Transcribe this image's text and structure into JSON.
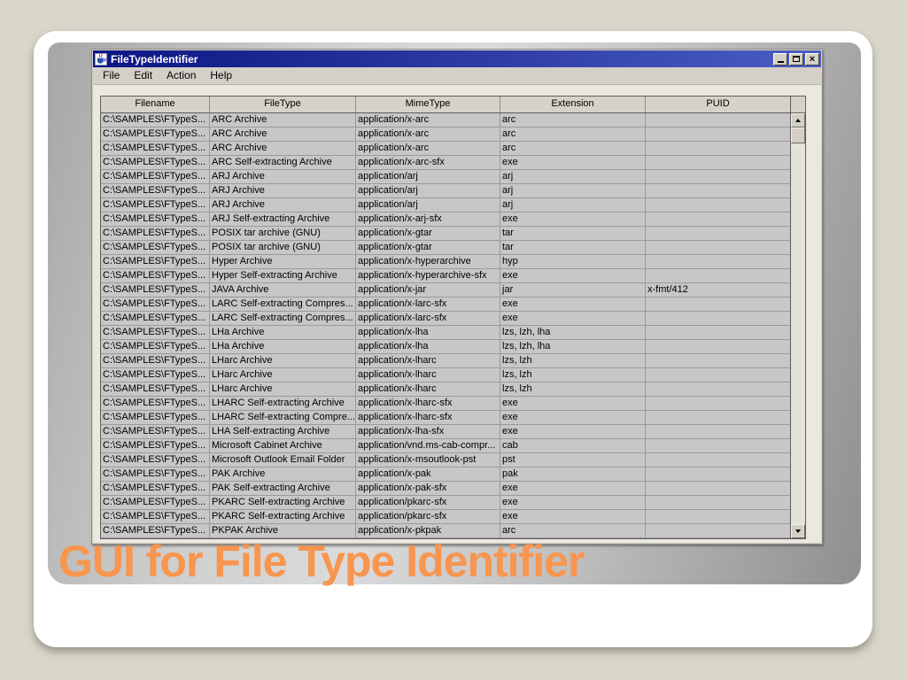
{
  "slide": {
    "title": "GUI for File Type Identifier",
    "accent_color": "#f8954f"
  },
  "window": {
    "title": "FileTypeIdentifier",
    "icon": "java-coffee-cup-icon",
    "controls": {
      "minimize": "minimize",
      "maximize": "maximize",
      "close": "×"
    },
    "menu": [
      "File",
      "Edit",
      "Action",
      "Help"
    ],
    "table": {
      "columns": [
        "Filename",
        "FileType",
        "MimeType",
        "Extension",
        "PUID"
      ],
      "rows": [
        [
          "C:\\SAMPLES\\FTypeS...",
          "ARC Archive",
          "application/x-arc",
          "arc",
          ""
        ],
        [
          "C:\\SAMPLES\\FTypeS...",
          "ARC Archive",
          "application/x-arc",
          "arc",
          ""
        ],
        [
          "C:\\SAMPLES\\FTypeS...",
          "ARC Archive",
          "application/x-arc",
          "arc",
          ""
        ],
        [
          "C:\\SAMPLES\\FTypeS...",
          "ARC Self-extracting Archive",
          "application/x-arc-sfx",
          "exe",
          ""
        ],
        [
          "C:\\SAMPLES\\FTypeS...",
          "ARJ Archive",
          "application/arj",
          "arj",
          ""
        ],
        [
          "C:\\SAMPLES\\FTypeS...",
          "ARJ Archive",
          "application/arj",
          "arj",
          ""
        ],
        [
          "C:\\SAMPLES\\FTypeS...",
          "ARJ Archive",
          "application/arj",
          "arj",
          ""
        ],
        [
          "C:\\SAMPLES\\FTypeS...",
          "ARJ Self-extracting Archive",
          "application/x-arj-sfx",
          "exe",
          ""
        ],
        [
          "C:\\SAMPLES\\FTypeS...",
          "POSIX tar archive (GNU)",
          "application/x-gtar",
          "tar",
          ""
        ],
        [
          "C:\\SAMPLES\\FTypeS...",
          "POSIX tar archive (GNU)",
          "application/x-gtar",
          "tar",
          ""
        ],
        [
          "C:\\SAMPLES\\FTypeS...",
          "Hyper Archive",
          "application/x-hyperarchive",
          "hyp",
          ""
        ],
        [
          "C:\\SAMPLES\\FTypeS...",
          "Hyper Self-extracting Archive",
          "application/x-hyperarchive-sfx",
          "exe",
          ""
        ],
        [
          "C:\\SAMPLES\\FTypeS...",
          "JAVA Archive",
          "application/x-jar",
          "jar",
          "x-fmt/412"
        ],
        [
          "C:\\SAMPLES\\FTypeS...",
          "LARC Self-extracting Compres...",
          "application/x-larc-sfx",
          "exe",
          ""
        ],
        [
          "C:\\SAMPLES\\FTypeS...",
          "LARC Self-extracting Compres...",
          "application/x-larc-sfx",
          "exe",
          ""
        ],
        [
          "C:\\SAMPLES\\FTypeS...",
          "LHa Archive",
          "application/x-lha",
          "lzs, lzh, lha",
          ""
        ],
        [
          "C:\\SAMPLES\\FTypeS...",
          "LHa Archive",
          "application/x-lha",
          "lzs, lzh, lha",
          ""
        ],
        [
          "C:\\SAMPLES\\FTypeS...",
          "LHarc Archive",
          "application/x-lharc",
          "lzs, lzh",
          ""
        ],
        [
          "C:\\SAMPLES\\FTypeS...",
          "LHarc Archive",
          "application/x-lharc",
          "lzs, lzh",
          ""
        ],
        [
          "C:\\SAMPLES\\FTypeS...",
          "LHarc Archive",
          "application/x-lharc",
          "lzs, lzh",
          ""
        ],
        [
          "C:\\SAMPLES\\FTypeS...",
          "LHARC Self-extracting Archive",
          "application/x-lharc-sfx",
          "exe",
          ""
        ],
        [
          "C:\\SAMPLES\\FTypeS...",
          "LHARC Self-extracting Compre...",
          "application/x-lharc-sfx",
          "exe",
          ""
        ],
        [
          "C:\\SAMPLES\\FTypeS...",
          "LHA Self-extracting Archive",
          "application/x-lha-sfx",
          "exe",
          ""
        ],
        [
          "C:\\SAMPLES\\FTypeS...",
          "Microsoft Cabinet Archive",
          "application/vnd.ms-cab-compr...",
          "cab",
          ""
        ],
        [
          "C:\\SAMPLES\\FTypeS...",
          "Microsoft Outlook Email Folder",
          "application/x-msoutlook-pst",
          "pst",
          ""
        ],
        [
          "C:\\SAMPLES\\FTypeS...",
          "PAK Archive",
          "application/x-pak",
          "pak",
          ""
        ],
        [
          "C:\\SAMPLES\\FTypeS...",
          "PAK Self-extracting Archive",
          "application/x-pak-sfx",
          "exe",
          ""
        ],
        [
          "C:\\SAMPLES\\FTypeS...",
          "PKARC Self-extracting Archive",
          "application/pkarc-sfx",
          "exe",
          ""
        ],
        [
          "C:\\SAMPLES\\FTypeS...",
          "PKARC Self-extracting Archive",
          "application/pkarc-sfx",
          "exe",
          ""
        ],
        [
          "C:\\SAMPLES\\FTypeS...",
          "PKPAK Archive",
          "application/x-pkpak",
          "arc",
          ""
        ]
      ]
    }
  }
}
